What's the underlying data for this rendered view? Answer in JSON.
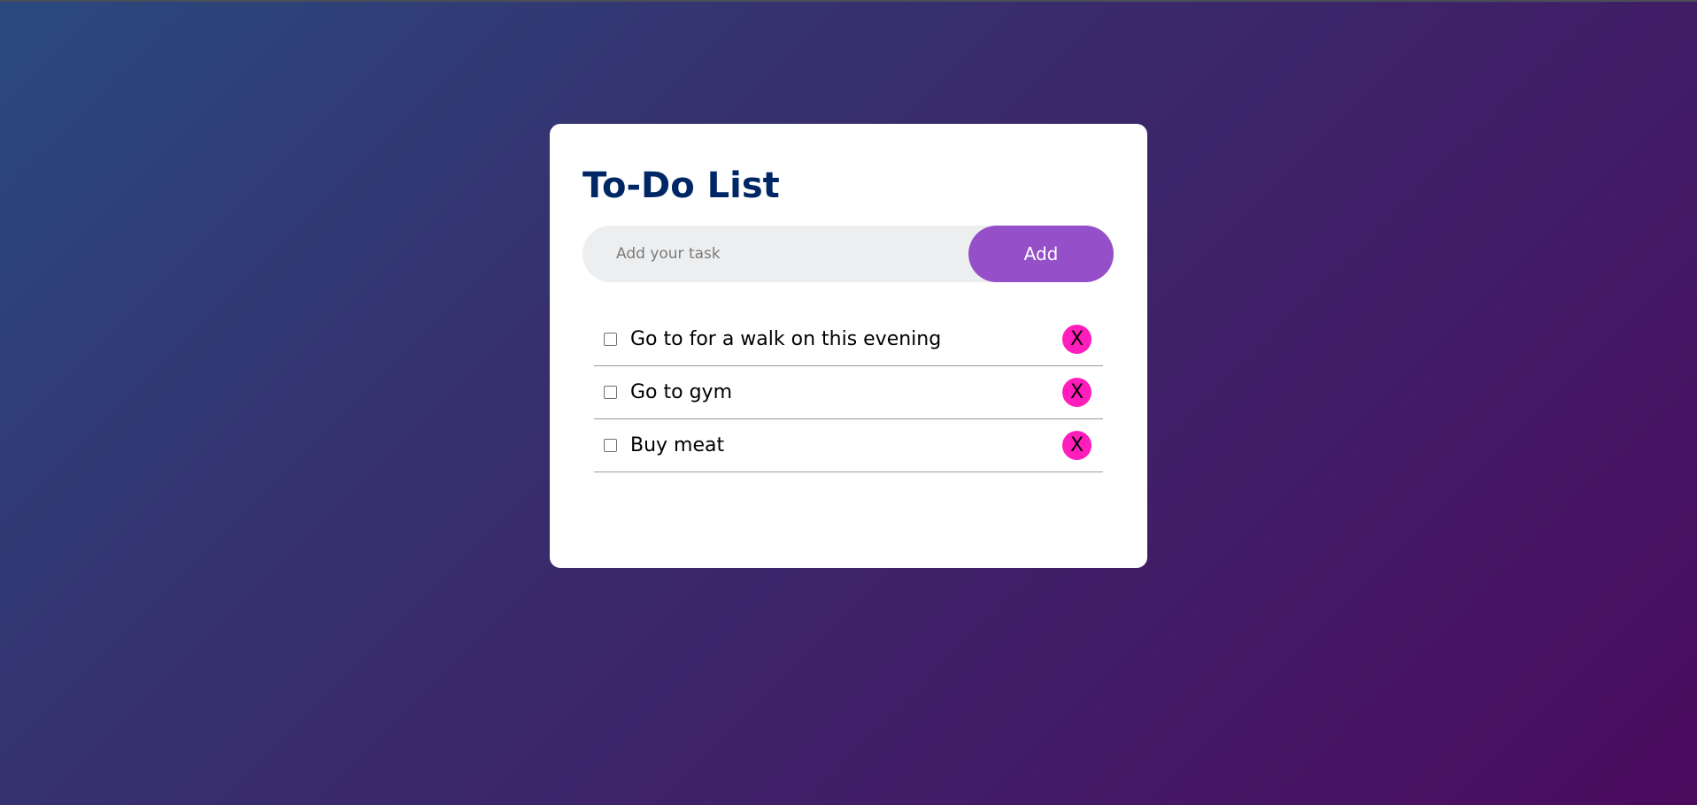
{
  "app": {
    "title": "To-Do List"
  },
  "input": {
    "placeholder": "Add your task",
    "value": ""
  },
  "add_button": {
    "label": "Add"
  },
  "tasks": [
    {
      "text": "Go to for a walk on this evening",
      "checked": false,
      "delete_label": "X"
    },
    {
      "text": "Go to gym",
      "checked": false,
      "delete_label": "X"
    },
    {
      "text": "Buy meat",
      "checked": false,
      "delete_label": "X"
    }
  ],
  "colors": {
    "title": "#002765",
    "add_button": "#954fc9",
    "delete_button": "#ff1dbb",
    "input_background": "#edeef0",
    "card": "#ffffff"
  },
  "icons": {
    "task_checkbox": "checkbox-icon"
  }
}
